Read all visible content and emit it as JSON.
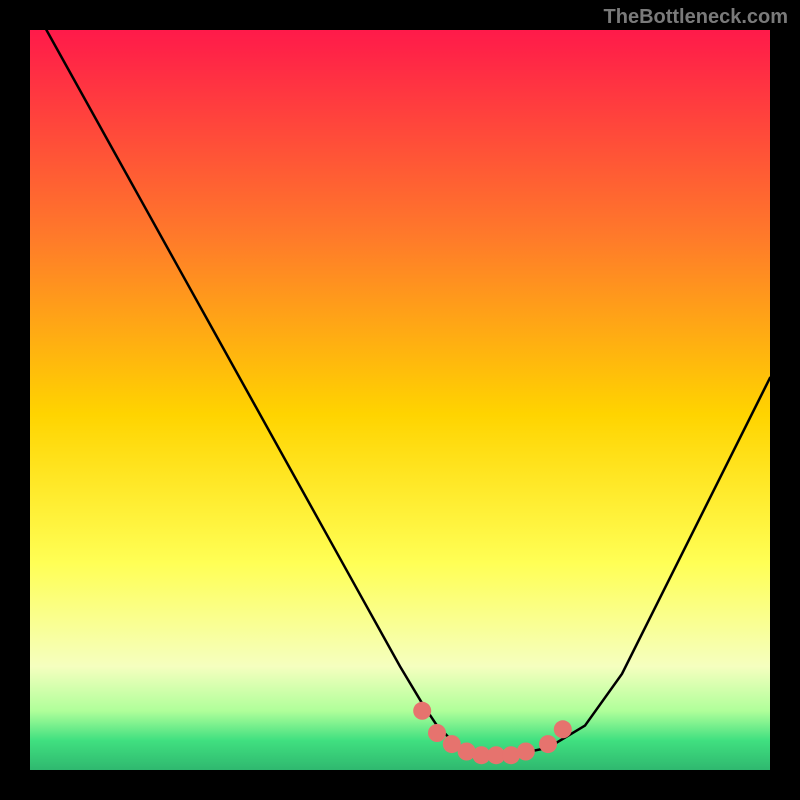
{
  "watermark": "TheBottleneck.com",
  "colors": {
    "background": "#000000",
    "gradient_top": "#ff1a4a",
    "gradient_mid1": "#ff7a2a",
    "gradient_mid2": "#ffd400",
    "gradient_mid3": "#ffff55",
    "gradient_mid4": "#f5ffbf",
    "gradient_bottom1": "#b0ff9a",
    "gradient_bottom2": "#40e080",
    "gradient_bottom3": "#2fb86f",
    "curve_stroke": "#000000",
    "marker_fill": "#e6736e"
  },
  "chart_data": {
    "type": "line",
    "title": "",
    "xlabel": "",
    "ylabel": "",
    "xlim": [
      0,
      100
    ],
    "ylim": [
      0,
      100
    ],
    "series": [
      {
        "name": "bottleneck-curve",
        "x": [
          0,
          5,
          10,
          15,
          20,
          25,
          30,
          35,
          40,
          45,
          50,
          53,
          55,
          58,
          60,
          63,
          65,
          70,
          75,
          80,
          85,
          90,
          95,
          100
        ],
        "y": [
          104,
          95,
          86,
          77,
          68,
          59,
          50,
          41,
          32,
          23,
          14,
          9,
          6,
          3,
          2,
          2,
          2,
          3,
          6,
          13,
          23,
          33,
          43,
          53
        ]
      }
    ],
    "markers": {
      "name": "optimal-range-markers",
      "x": [
        53,
        55,
        57,
        59,
        61,
        63,
        65,
        67,
        70,
        72
      ],
      "y": [
        8,
        5,
        3.5,
        2.5,
        2,
        2,
        2,
        2.5,
        3.5,
        5.5
      ]
    }
  }
}
